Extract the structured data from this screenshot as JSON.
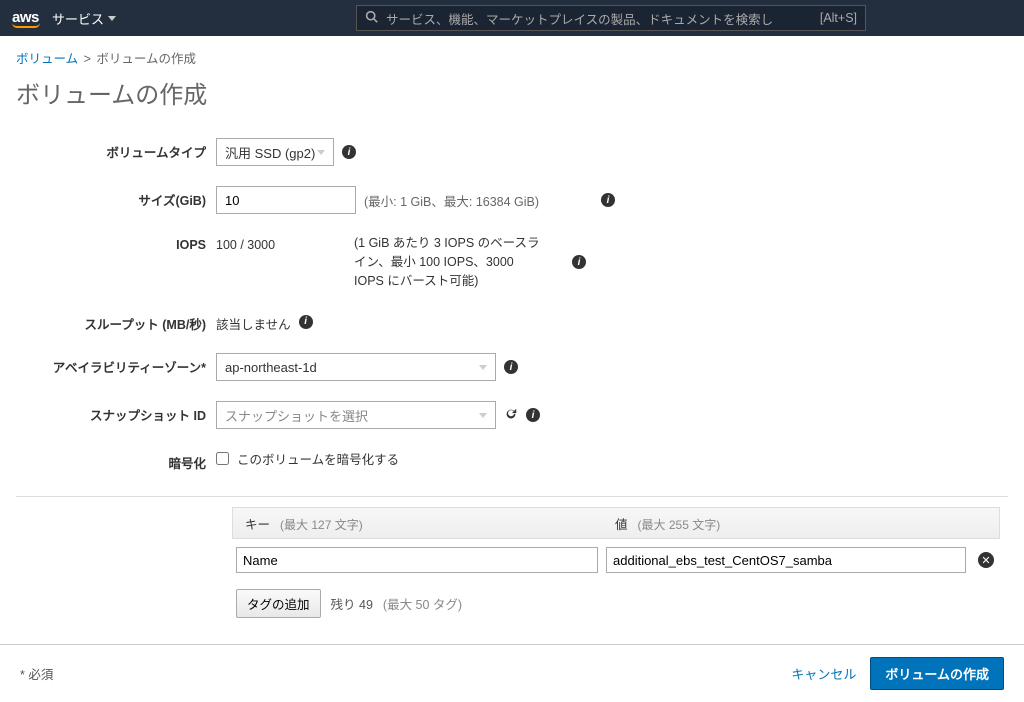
{
  "nav": {
    "logo": "aws",
    "services": "サービス",
    "search_placeholder": "サービス、機能、マーケットプレイスの製品、ドキュメントを検索し",
    "search_kbd": "[Alt+S]"
  },
  "breadcrumb": {
    "parent": "ボリューム",
    "current": "ボリュームの作成"
  },
  "page_title": "ボリュームの作成",
  "form": {
    "volume_type": {
      "label": "ボリュームタイプ",
      "value": "汎用 SSD (gp2)"
    },
    "size": {
      "label": "サイズ(GiB)",
      "value": "10",
      "hint": "(最小: 1 GiB、最大: 16384 GiB)"
    },
    "iops": {
      "label": "IOPS",
      "value": "100 / 3000",
      "note": "(1 GiB あたり 3 IOPS のベースライン、最小 100 IOPS、3000 IOPS にバースト可能)"
    },
    "throughput": {
      "label": "スループット (MB/秒)",
      "value": "該当しません"
    },
    "az": {
      "label": "アベイラビリティーゾーン*",
      "value": "ap-northeast-1d"
    },
    "snapshot": {
      "label": "スナップショット ID",
      "placeholder": "スナップショットを選択"
    },
    "encrypt": {
      "label": "暗号化",
      "checkbox_label": "このボリュームを暗号化する"
    }
  },
  "tags": {
    "key_header": "キー",
    "key_hint": "(最大 127 文字)",
    "value_header": "値",
    "value_hint": "(最大 255 文字)",
    "rows": [
      {
        "key": "Name",
        "value": "additional_ebs_test_CentOS7_samba"
      }
    ],
    "add_button": "タグの追加",
    "remaining": "残り 49",
    "max": "(最大 50 タグ)"
  },
  "footer": {
    "required_note": "* 必須",
    "cancel": "キャンセル",
    "submit": "ボリュームの作成"
  }
}
